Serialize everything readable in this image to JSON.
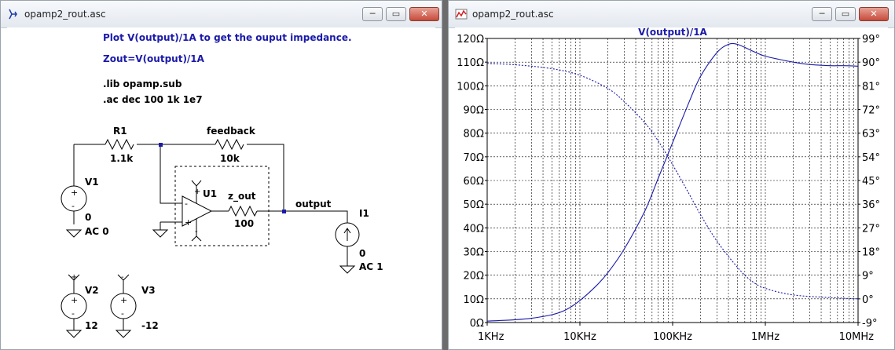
{
  "schematic_window": {
    "title": "opamp2_rout.asc",
    "buttons": {
      "minimize": "─",
      "maximize": "▭",
      "close": "✕"
    },
    "directives": {
      "line1": "Plot V(output)/1A to get the ouput impedance.",
      "line2": "Zout=V(output)/1A",
      "line3": ".lib opamp.sub",
      "line4": ".ac dec 100 1k 1e7"
    },
    "components": {
      "r1_name": "R1",
      "r1_value": "1.1k",
      "rf_name": "feedback",
      "rf_value": "10k",
      "zout_name": "z_out",
      "zout_value": "100",
      "u1_name": "U1",
      "v1_name": "V1",
      "v1_value": "0",
      "v1_ac": "AC 0",
      "i1_name": "I1",
      "i1_value": "0",
      "i1_ac": "AC 1",
      "v2_name": "V2",
      "v2_value": "12",
      "v3_name": "V3",
      "v3_value": "-12",
      "net_output": "output",
      "plus": "+",
      "minus": "-"
    }
  },
  "plot_window": {
    "title": "opamp2_rout.asc",
    "buttons": {
      "minimize": "─",
      "maximize": "▭",
      "close": "✕"
    }
  },
  "chart_data": {
    "type": "line",
    "title": "V(output)/1A",
    "x_scale": "log",
    "x_range": [
      1000,
      10000000
    ],
    "x_ticks": [
      "1KHz",
      "10KHz",
      "100KHz",
      "1MHz",
      "10MHz"
    ],
    "y_left_range": [
      0,
      120
    ],
    "y_left_ticks": [
      "0Ω",
      "10Ω",
      "20Ω",
      "30Ω",
      "40Ω",
      "50Ω",
      "60Ω",
      "70Ω",
      "80Ω",
      "90Ω",
      "100Ω",
      "110Ω",
      "120Ω"
    ],
    "y_right_range": [
      -9,
      99
    ],
    "y_right_ticks": [
      "-9°",
      "0°",
      "9°",
      "18°",
      "27°",
      "36°",
      "45°",
      "54°",
      "63°",
      "72°",
      "81°",
      "90°",
      "99°"
    ],
    "grid": true,
    "colors": {
      "trace": "#1a1aa8",
      "grid": "#000000"
    },
    "series": [
      {
        "axis": "left",
        "style": "solid",
        "x": [
          1000,
          2000,
          3000,
          5000,
          7000,
          10000,
          15000,
          20000,
          30000,
          50000,
          70000,
          100000,
          150000,
          200000,
          300000,
          400000,
          500000,
          700000,
          1000000,
          2000000,
          3000000,
          5000000,
          7000000,
          10000000
        ],
        "y": [
          0.6,
          1.2,
          1.8,
          3.3,
          5.3,
          9.3,
          15.5,
          21,
          31,
          47,
          61,
          76,
          93,
          104,
          114,
          117.5,
          117.5,
          115,
          112.5,
          110,
          109,
          108.5,
          108.5,
          108.3
        ]
      },
      {
        "axis": "right",
        "style": "dashed",
        "x": [
          1000,
          2000,
          5000,
          10000,
          20000,
          30000,
          50000,
          70000,
          100000,
          150000,
          200000,
          300000,
          500000,
          700000,
          1000000,
          2000000,
          5000000,
          10000000
        ],
        "y": [
          89.5,
          89,
          87.5,
          85,
          80,
          75,
          67,
          60,
          51,
          40,
          32,
          22,
          12,
          7,
          4,
          1.5,
          0.5,
          0
        ]
      }
    ]
  }
}
